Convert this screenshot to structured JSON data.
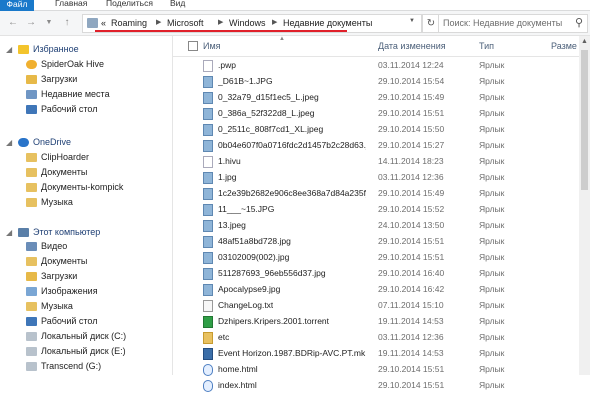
{
  "ribbon": {
    "tabs": [
      "Файл",
      "Главная",
      "Поделиться",
      "Вид"
    ]
  },
  "address": {
    "prefix": "«",
    "crumbs": [
      "Roaming",
      "Microsoft",
      "Windows",
      "Недавние документы"
    ]
  },
  "search": {
    "placeholder": "Поиск: Недавние документы"
  },
  "nav": {
    "favorites_label": "Избранное",
    "favorites": [
      "SpiderOak Hive",
      "Загрузки",
      "Недавние места",
      "Рабочий стол"
    ],
    "onedrive_label": "OneDrive",
    "onedrive": [
      "ClipHoarder",
      "Документы",
      "Документы-kompick",
      "Музыка"
    ],
    "computer_label": "Этот компьютер",
    "computer": [
      "Видео",
      "Документы",
      "Загрузки",
      "Изображения",
      "Музыка",
      "Рабочий стол",
      "Локальный диск (C:)",
      "Локальный диск (E:)",
      "Transcend (G:)"
    ]
  },
  "columns": {
    "name": "Имя",
    "date": "Дата изменения",
    "type": "Тип",
    "size": "Разме"
  },
  "files": [
    {
      "name": ".pwp",
      "date": "03.11.2014 12:24",
      "type": "Ярлык",
      "icon": "file"
    },
    {
      "name": "_D61B~1.JPG",
      "date": "29.10.2014 15:54",
      "type": "Ярлык",
      "icon": "img"
    },
    {
      "name": "0_32a79_d15f1ec5_L.jpeg",
      "date": "29.10.2014 15:49",
      "type": "Ярлык",
      "icon": "img"
    },
    {
      "name": "0_386a_52f322d8_L.jpeg",
      "date": "29.10.2014 15:51",
      "type": "Ярлык",
      "icon": "img"
    },
    {
      "name": "0_2511c_808f7cd1_XL.jpeg",
      "date": "29.10.2014 15:50",
      "type": "Ярлык",
      "icon": "img"
    },
    {
      "name": "0b04e607f0a0716fdc2d1457b2c28d63.j...",
      "date": "29.10.2014 15:27",
      "type": "Ярлык",
      "icon": "img"
    },
    {
      "name": "1.hivu",
      "date": "14.11.2014 18:23",
      "type": "Ярлык",
      "icon": "file"
    },
    {
      "name": "1.jpg",
      "date": "03.11.2014 12:36",
      "type": "Ярлык",
      "icon": "img"
    },
    {
      "name": "1c2e39b2682e906c8ee368a7d84a235f_f...",
      "date": "29.10.2014 15:49",
      "type": "Ярлык",
      "icon": "img"
    },
    {
      "name": "11___~15.JPG",
      "date": "29.10.2014 15:52",
      "type": "Ярлык",
      "icon": "img"
    },
    {
      "name": "13.jpeg",
      "date": "24.10.2014 13:50",
      "type": "Ярлык",
      "icon": "img"
    },
    {
      "name": "48af51a8bd728.jpg",
      "date": "29.10.2014 15:51",
      "type": "Ярлык",
      "icon": "img"
    },
    {
      "name": "03102009(002).jpg",
      "date": "29.10.2014 15:51",
      "type": "Ярлык",
      "icon": "img"
    },
    {
      "name": "511287693_96eb556d37.jpg",
      "date": "29.10.2014 16:40",
      "type": "Ярлык",
      "icon": "img"
    },
    {
      "name": "Apocalypse9.jpg",
      "date": "29.10.2014 16:42",
      "type": "Ярлык",
      "icon": "img"
    },
    {
      "name": "ChangeLog.txt",
      "date": "07.11.2014 15:10",
      "type": "Ярлык",
      "icon": "txt"
    },
    {
      "name": "Dzhipers.Kripers.2001.torrent",
      "date": "19.11.2014 14:53",
      "type": "Ярлык",
      "icon": "exe"
    },
    {
      "name": "etc",
      "date": "03.11.2014 12:36",
      "type": "Ярлык",
      "icon": "fold"
    },
    {
      "name": "Event Horizon.1987.BDRip-AVC.PT.mk...",
      "date": "19.11.2014 14:53",
      "type": "Ярлык",
      "icon": "vid"
    },
    {
      "name": "home.html",
      "date": "29.10.2014 15:51",
      "type": "Ярлык",
      "icon": "web"
    },
    {
      "name": "index.html",
      "date": "29.10.2014 15:51",
      "type": "Ярлык",
      "icon": "web"
    }
  ]
}
